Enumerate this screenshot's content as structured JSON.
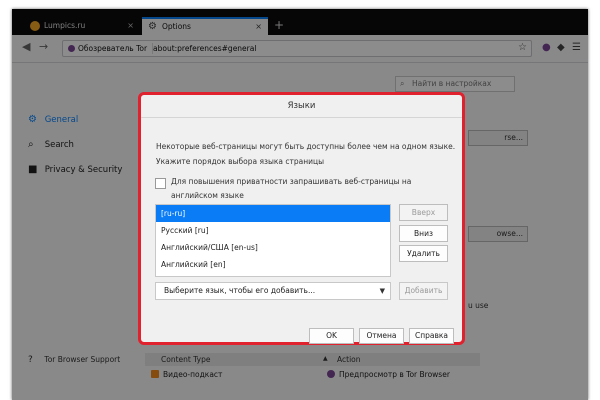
{
  "browser": {
    "tabs": [
      {
        "label": "Lumpics.ru",
        "active": false
      },
      {
        "label": "Options",
        "active": true
      }
    ],
    "new_tab_label": "+",
    "close_glyph": "×",
    "identity_label": "Обозреватель Tor",
    "url": "about:preferences#general",
    "icons": {
      "back": "◀",
      "forward": "→",
      "reload": "⟳",
      "star": "☆",
      "shield": "◆",
      "onion": "●",
      "menu": "☰",
      "gear": "⚙",
      "search": "🔍",
      "lock": "🔒",
      "help": "?",
      "lumpics": "●"
    }
  },
  "prefs": {
    "search_placeholder": "Найти в настройках",
    "categories": [
      {
        "label": "General"
      },
      {
        "label": "Search"
      },
      {
        "label": "Privacy & Security"
      }
    ],
    "support_label": "Tor Browser Support",
    "bg_fragments": {
      "rse": "rse...",
      "dowse": "owse...",
      "use": "u use"
    },
    "content_table": {
      "col1": "Content Type",
      "col2": "Action",
      "row_type": "Видео-подкаст",
      "row_action": "Предпросмотр в Tor Browser"
    }
  },
  "dialog": {
    "title": "Языки",
    "intro_line1": "Некоторые веб-страницы могут быть доступны более чем на одном языке.",
    "intro_line2": "Укажите порядок выбора языка страницы",
    "checkbox_label": "Для повышения приватности запрашивать веб-страницы на английском языке",
    "languages": [
      {
        "label": "[ru-ru]",
        "selected": true
      },
      {
        "label": "Русский  [ru]",
        "selected": false
      },
      {
        "label": "Английский/США  [en-us]",
        "selected": false
      },
      {
        "label": "Английский  [en]",
        "selected": false
      }
    ],
    "up_label": "Вверх",
    "down_label": "Вниз",
    "remove_label": "Удалить",
    "select_placeholder": "Выберите язык, чтобы его добавить...",
    "add_label": "Добавить",
    "ok_label": "OK",
    "cancel_label": "Отмена",
    "help_label": "Справка"
  },
  "colors": {
    "accent": "#0a84ff",
    "dialog_border": "#e0212e",
    "selection": "#0a7cf5"
  }
}
